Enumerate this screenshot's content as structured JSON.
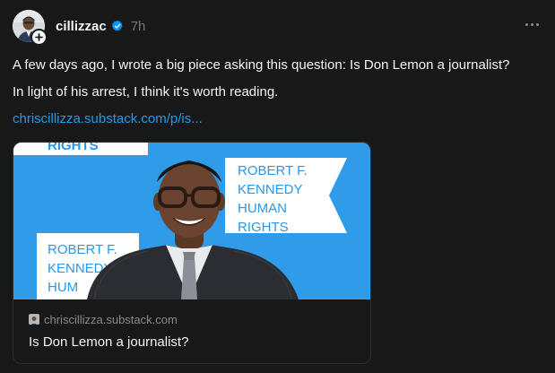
{
  "post": {
    "username": "cillizzac",
    "time": "7h",
    "lines": [
      "A few days ago, I wrote a big piece asking this question: Is Don Lemon a journalist?",
      "In light of his arrest, I think it's worth reading."
    ],
    "link_text": "chriscillizza.substack.com/p/is..."
  },
  "card": {
    "image_sign_texts": {
      "right_sign": [
        "ROBERT F.",
        "KENNEDY",
        "HUMAN",
        "RIGHTS"
      ],
      "left_sign": [
        "ROBERT F.",
        "KENNEDY",
        "HUM"
      ],
      "top_fragment": "RIGHTS"
    },
    "domain": "chriscillizza.substack.com",
    "title": "Is Don Lemon a journalist?"
  },
  "icons": {
    "avatar": "profile-photo",
    "follow": "plus-icon",
    "verified": "verified-badge-icon",
    "more": "more-horizontal-icon",
    "favicon": "site-favicon"
  },
  "colors": {
    "background": "#181818",
    "text": "#f3f5f7",
    "muted": "#777777",
    "link": "#1d9bf0",
    "verified": "#0095f6",
    "sign_blue": "#2a97e6",
    "sign_white": "#ffffff"
  }
}
